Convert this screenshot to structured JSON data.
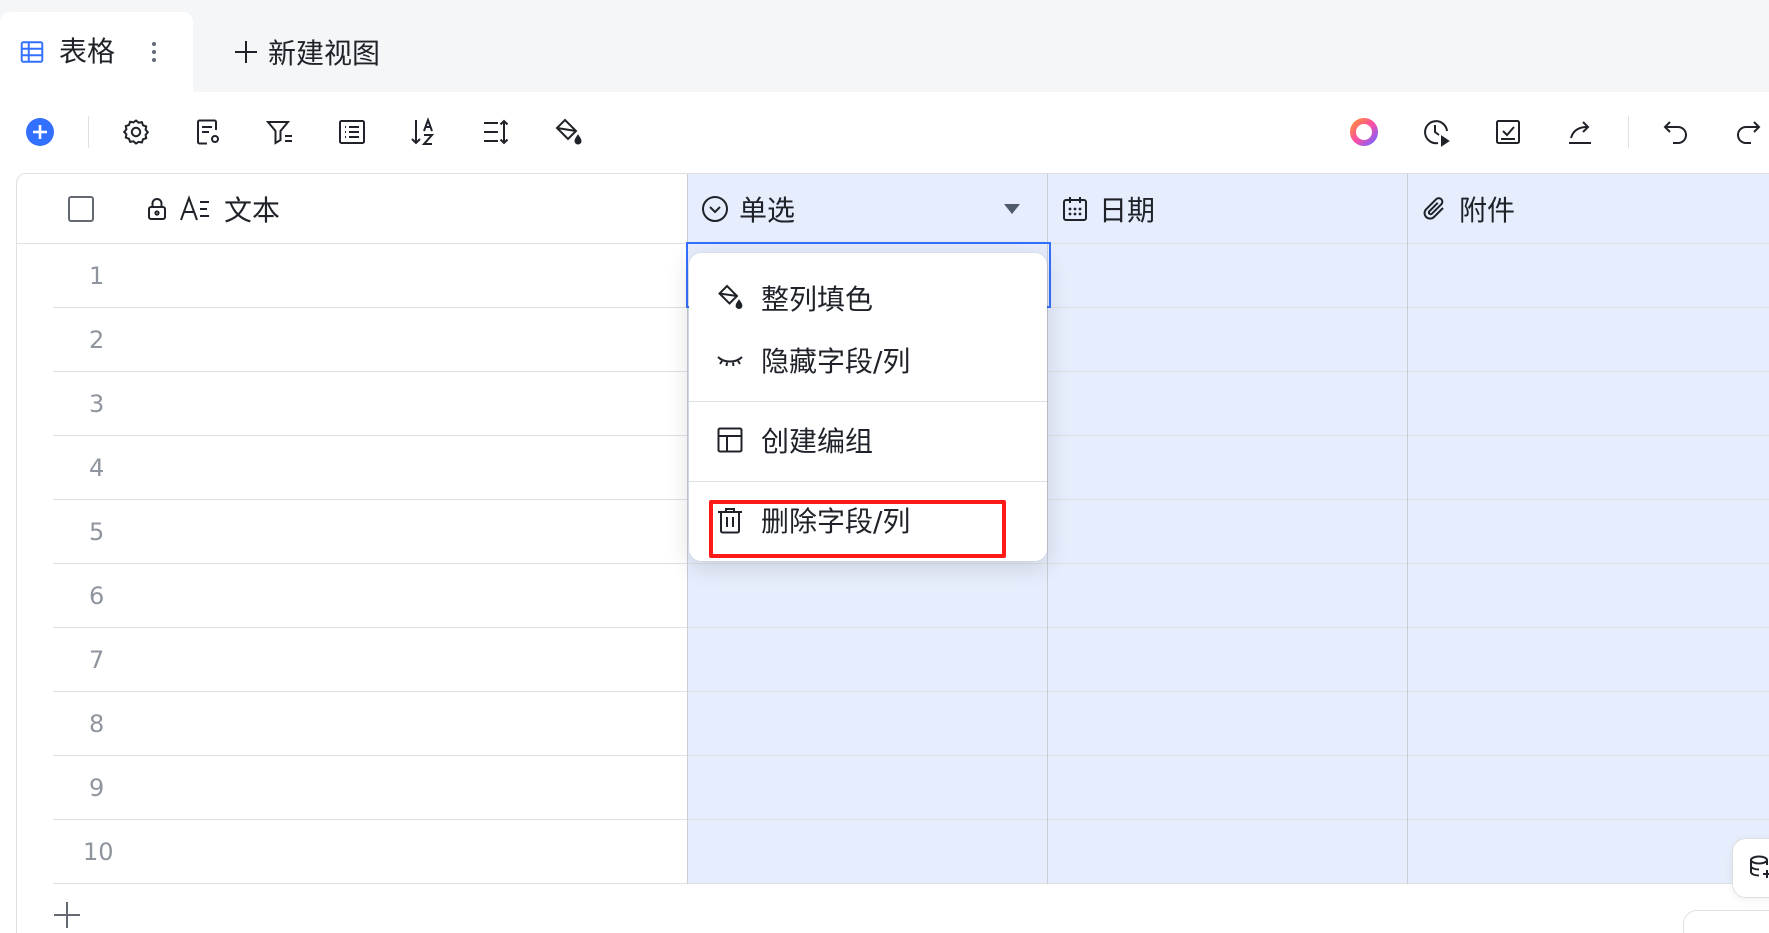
{
  "tabs": {
    "active_label": "表格",
    "new_view_label": "新建视图"
  },
  "table": {
    "columns": [
      {
        "name": "文本",
        "type": "text",
        "locked": true
      },
      {
        "name": "单选",
        "type": "single-select",
        "selected": true
      },
      {
        "name": "日期",
        "type": "date"
      },
      {
        "name": "附件",
        "type": "attachment"
      }
    ],
    "rows": [
      "1",
      "2",
      "3",
      "4",
      "5",
      "6",
      "7",
      "8",
      "9",
      "10"
    ]
  },
  "context_menu": {
    "items": [
      {
        "label": "整列填色",
        "icon": "paint-bucket-icon"
      },
      {
        "label": "隐藏字段/列",
        "icon": "eye-closed-icon"
      },
      {
        "label": "创建编组",
        "icon": "layout-icon"
      },
      {
        "label": "删除字段/列",
        "icon": "trash-icon",
        "highlighted": true
      }
    ]
  },
  "colors": {
    "accent": "#3370ff",
    "selected_column_bg": "#e6edfc",
    "highlight_border": "#ff1a1a",
    "tabbar_bg": "#f5f6f7"
  }
}
